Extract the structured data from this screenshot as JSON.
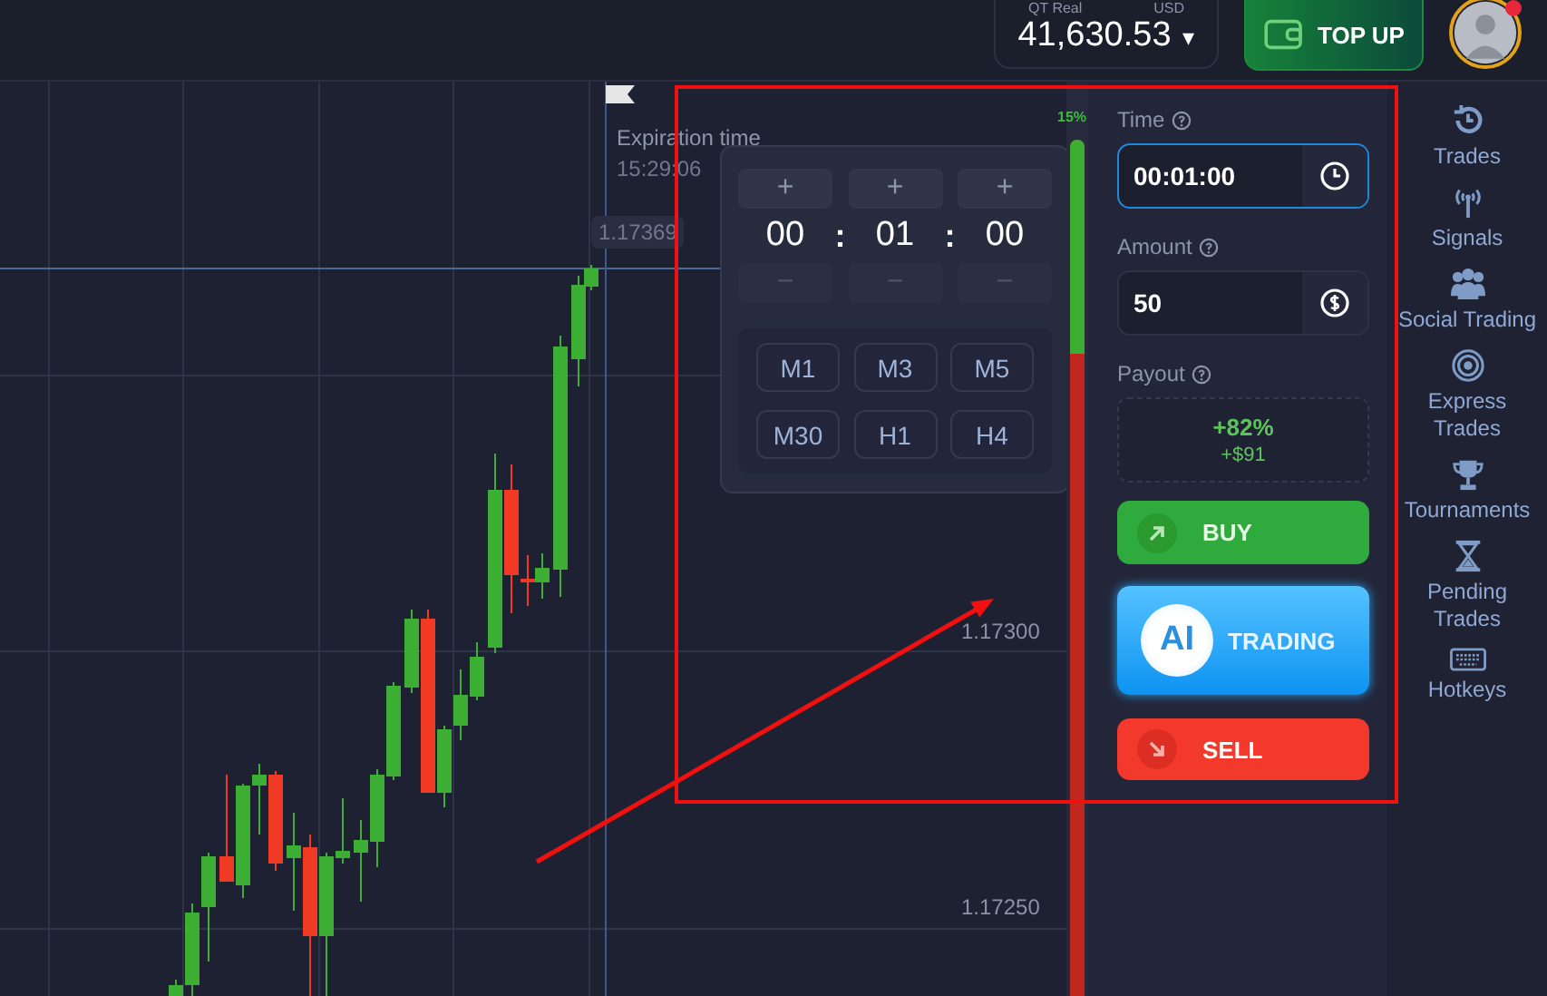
{
  "account": {
    "label": "QT Real",
    "currency": "USD",
    "balance": "41,630.53",
    "caret": "▾"
  },
  "top_up": "TOP UP",
  "avatar": {
    "has_notification": true
  },
  "chart": {
    "expiration_label": "Expiration time",
    "expiration_time": "15:29:06",
    "current_price": "1.17369",
    "price_labels": [
      "1.17300",
      "1.17250"
    ]
  },
  "sentiment": {
    "reading": "15%",
    "level": 0.25
  },
  "time_picker": {
    "fields": [
      {
        "plus": "+",
        "value": "00",
        "minus": "−"
      },
      {
        "plus": "+",
        "value": "01",
        "minus": "−"
      },
      {
        "plus": "+",
        "value": "00",
        "minus": "−"
      }
    ],
    "separators": [
      ":",
      ":"
    ],
    "presets": [
      "M1",
      "M3",
      "M5",
      "M30",
      "H1",
      "H4"
    ]
  },
  "trade": {
    "time_label": "Time",
    "time_value": "00:01:00",
    "amount_label": "Amount",
    "amount_value": "50",
    "payout_label": "Payout",
    "payout_percent": "+82%",
    "payout_amount": "+$91",
    "buy": "BUY",
    "ai_badge": "AI",
    "ai_label": "TRADING",
    "sell": "SELL"
  },
  "sidebar": {
    "items": [
      {
        "label": "Trades"
      },
      {
        "label": "Signals"
      },
      {
        "label": "Social Trading"
      },
      {
        "label": "Express Trades"
      },
      {
        "label": "Tournaments"
      },
      {
        "label": "Pending Trades"
      },
      {
        "label": "Hotkeys"
      }
    ]
  }
}
